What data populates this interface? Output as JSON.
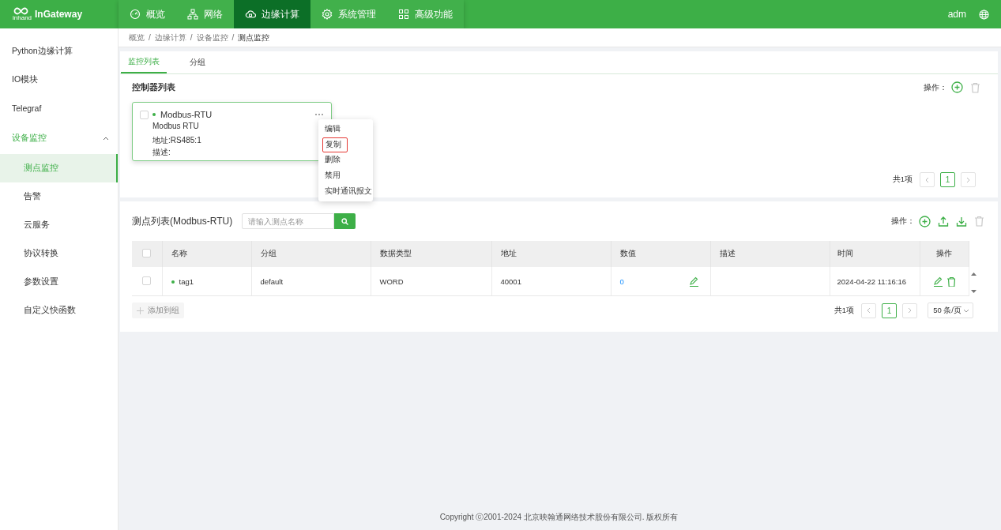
{
  "header": {
    "logo": "InGateway",
    "logo_sub": "inhand",
    "nav": [
      {
        "label": "概览",
        "selected": false
      },
      {
        "label": "网络",
        "selected": false
      },
      {
        "label": "边缘计算",
        "selected": true
      },
      {
        "label": "系统管理",
        "selected": false
      },
      {
        "label": "高级功能",
        "selected": false
      }
    ],
    "user": "adm"
  },
  "sidebar": {
    "items": [
      {
        "label": "Python边缘计算",
        "selected": false
      },
      {
        "label": "IO模块",
        "selected": false
      },
      {
        "label": "Telegraf",
        "selected": false
      },
      {
        "label": "设备监控",
        "selected": false,
        "expanded": true,
        "children": [
          {
            "label": "测点监控",
            "selected": true
          },
          {
            "label": "告警",
            "selected": false
          },
          {
            "label": "云服务",
            "selected": false
          },
          {
            "label": "协议转换",
            "selected": false
          },
          {
            "label": "参数设置",
            "selected": false
          },
          {
            "label": "自定义快函数",
            "selected": false
          }
        ]
      }
    ]
  },
  "breadcrumb": {
    "separator": "/",
    "items": [
      "概览",
      "边缘计算",
      "设备监控",
      "测点监控"
    ]
  },
  "tabs": [
    {
      "label": "监控列表",
      "selected": true
    },
    {
      "label": "分组",
      "selected": false
    }
  ],
  "controllers": {
    "title": "控制器列表",
    "ops_label": "操作：",
    "cards": [
      {
        "name": "Modbus-RTU",
        "online": true,
        "checked": false,
        "protocol": "Modbus RTU",
        "address": "地址:RS485:1",
        "description": "描述:"
      }
    ],
    "menu": [
      {
        "label": "编辑",
        "highlighted": false
      },
      {
        "label": "复制",
        "highlighted": true
      },
      {
        "label": "删除",
        "highlighted": false
      },
      {
        "label": "禁用",
        "highlighted": false
      },
      {
        "label": "实时通讯报文",
        "highlighted": false
      }
    ],
    "pagination": {
      "total": "共1项",
      "pages": [
        {
          "label": "1",
          "selected": true
        }
      ]
    }
  },
  "points": {
    "title": "测点列表(Modbus-RTU)",
    "search": {
      "placeholder": "请输入测点名称"
    },
    "ops_label": "操作：",
    "header_checked": false,
    "columns": [
      "名称",
      "分组",
      "数据类型",
      "地址",
      "数值",
      "描述",
      "时间",
      "操作"
    ],
    "rows": [
      {
        "checked": false,
        "online": true,
        "name": "tag1",
        "group": "default",
        "type": "WORD",
        "address": "40001",
        "value": "0",
        "time": "2024-04-22 11:16:16"
      }
    ],
    "add_group": {
      "label": "添加到组",
      "disabled": true
    },
    "pagination": {
      "total": "共1项",
      "pages": [
        {
          "label": "1",
          "selected": true
        }
      ]
    },
    "page_size": "50 条/页"
  },
  "footer": "Copyright ⓒ2001-2024 北京映翰通网络技术股份有限公司. 版权所有"
}
